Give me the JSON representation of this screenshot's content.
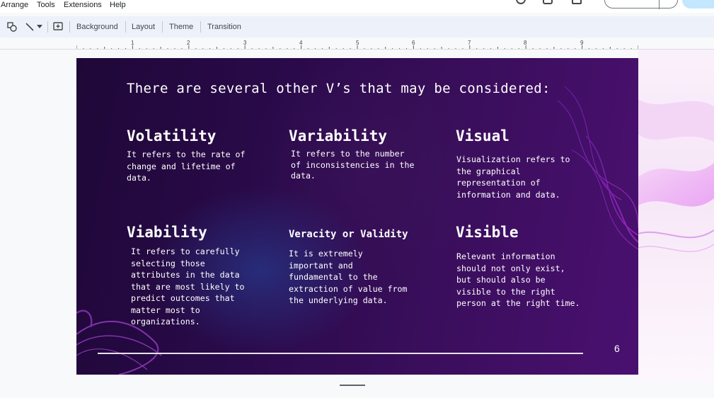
{
  "menu": {
    "items": [
      "Arrange",
      "Tools",
      "Extensions",
      "Help"
    ]
  },
  "toolbar": {
    "background_label": "Background",
    "layout_label": "Layout",
    "theme_label": "Theme",
    "transition_label": "Transition"
  },
  "ruler": {
    "numbers": [
      "1",
      "2",
      "3",
      "4",
      "5",
      "6",
      "7",
      "8",
      "9"
    ]
  },
  "slide": {
    "title": "There are several other V’s that may be considered:",
    "items": [
      {
        "heading": "Volatility",
        "body": "It refers to the rate of\nchange and lifetime of\ndata."
      },
      {
        "heading": "Variability",
        "body": "It refers to the number\nof inconsistencies in the\ndata."
      },
      {
        "heading": "Visual",
        "body": "Visualization refers to\nthe graphical\nrepresentation of\ninformation and data."
      },
      {
        "heading": "Viability",
        "body": "It refers to carefully\nselecting those\nattributes in the data\nthat are most likely to\npredict outcomes that\nmatter most to\norganizations."
      },
      {
        "heading": "Veracity or Validity",
        "body": "It is extremely\nimportant and\nfundamental to the\nextraction of value from\nthe underlying data."
      },
      {
        "heading": "Visible",
        "body": "Relevant information\nshould not only exist,\nbut should also be\nvisible to the right\nperson at the right time."
      }
    ],
    "slide_number": "6"
  },
  "colors": {
    "slide_bg_dark": "#1f0838",
    "slide_bg_purple": "#4a1070",
    "accent_pink": "#e040fb",
    "toolbar_bg": "#edf2fa",
    "share_bg": "#c2e7ff"
  },
  "icons": {
    "shape": "shapes-icon",
    "line": "line-icon",
    "comment": "add-comment-icon",
    "history": "history-icon",
    "chat": "chat-icon",
    "meet": "meet-icon"
  }
}
